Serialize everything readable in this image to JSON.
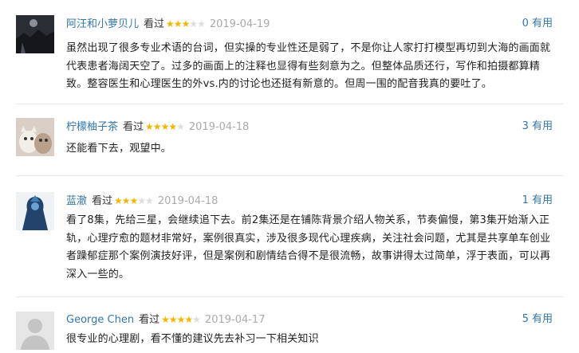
{
  "reviews": [
    {
      "username": "阿汪和小萝贝儿",
      "watched": "看过",
      "stars": 3,
      "date": "2019-04-19",
      "useful": "0 有用",
      "text": "虽然出现了很多专业术语的台词，但实操的专业性还是弱了，不是你让人家打打模型再切到大海的画面就代表患者海阔天空了。过多的画面上的注释也显得有些刻意为之。但整体品质还行，写作和拍摄都算精致。整容医生和心理医生的外vs.内的讨论也还挺有新意的。但周一围的配音我真的要吐了。"
    },
    {
      "username": "柠檬柚子茶",
      "watched": "看过",
      "stars": 4,
      "date": "2019-04-18",
      "useful": "3 有用",
      "text": "还能看下去，观望中。"
    },
    {
      "username": "蓝澈",
      "watched": "看过",
      "stars": 3,
      "date": "2019-04-18",
      "useful": "1 有用",
      "text": "看了8集，先给三星，会继续追下去。前2集还是在铺陈背景介绍人物关系，节奏偏慢，第3集开始渐入正轨，心理疗愈的题材非常好，案例很真实，涉及很多现代心理疾病，关注社会问题，尤其是共享单车创业者躁郁症那个案例演技好评，但是案例和剧情结合得不是很流畅，故事讲得太过简单，浮于表面，可以再深入一些的。"
    },
    {
      "username": "George Chen",
      "watched": "看过",
      "stars": 4,
      "date": "2019-04-17",
      "useful": "5 有用",
      "text": "很专业的心理剧，看不懂的建议先去补习一下相关知识"
    }
  ],
  "colors": {
    "link": "#3377aa",
    "star_on": "#f5b600",
    "star_off": "#dddddd",
    "date": "#aaaaaa"
  }
}
